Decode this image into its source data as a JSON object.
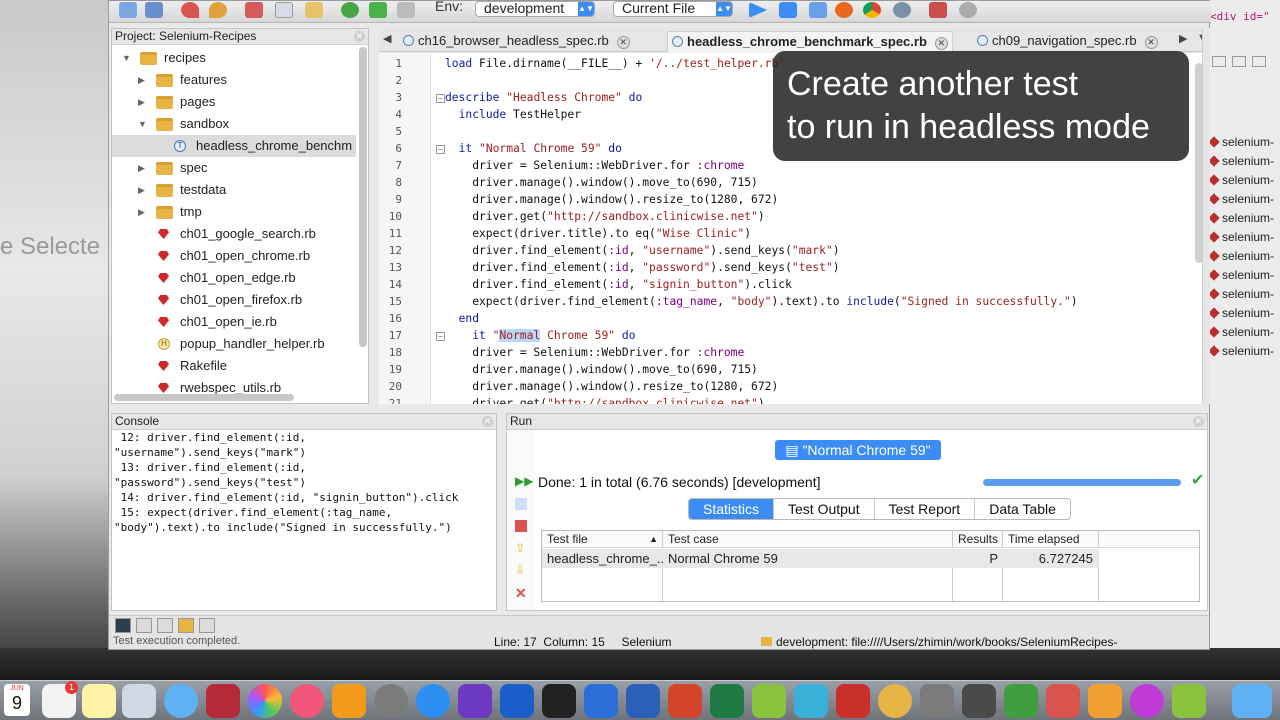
{
  "desktop": {
    "left_fragment": "e Selecte",
    "right_code": "<div id=\"",
    "right_items": [
      "selenium-",
      "selenium-",
      "selenium-",
      "selenium-",
      "selenium-",
      "selenium-",
      "selenium-",
      "selenium-",
      "selenium-",
      "selenium-",
      "selenium-",
      "selenium-"
    ]
  },
  "toolbar": {
    "env_label": "Env:",
    "env_value": "development",
    "scope_value": "Current File"
  },
  "project": {
    "title": "Project: Selenium-Recipes",
    "tree": [
      {
        "label": "recipes",
        "kind": "folder",
        "indent": 0,
        "state": "open"
      },
      {
        "label": "features",
        "kind": "folder",
        "indent": 1,
        "state": "closed"
      },
      {
        "label": "pages",
        "kind": "folder",
        "indent": 1,
        "state": "closed"
      },
      {
        "label": "sandbox",
        "kind": "folder",
        "indent": 1,
        "state": "open"
      },
      {
        "label": "headless_chrome_benchm",
        "kind": "test",
        "indent": 2,
        "state": "selected"
      },
      {
        "label": "spec",
        "kind": "folder",
        "indent": 1,
        "state": "closed"
      },
      {
        "label": "testdata",
        "kind": "folder",
        "indent": 1,
        "state": "closed"
      },
      {
        "label": "tmp",
        "kind": "folder",
        "indent": 1,
        "state": "closed"
      },
      {
        "label": "ch01_google_search.rb",
        "kind": "ruby",
        "indent": 1
      },
      {
        "label": "ch01_open_chrome.rb",
        "kind": "ruby",
        "indent": 1
      },
      {
        "label": "ch01_open_edge.rb",
        "kind": "ruby",
        "indent": 1
      },
      {
        "label": "ch01_open_firefox.rb",
        "kind": "ruby",
        "indent": 1
      },
      {
        "label": "ch01_open_ie.rb",
        "kind": "ruby",
        "indent": 1
      },
      {
        "label": "popup_handler_helper.rb",
        "kind": "helper",
        "indent": 1
      },
      {
        "label": "Rakefile",
        "kind": "ruby",
        "indent": 1
      },
      {
        "label": "rwebspec_utils.rb",
        "kind": "ruby",
        "indent": 1
      }
    ]
  },
  "tabs": [
    {
      "label": "ch16_browser_headless_spec.rb",
      "active": false
    },
    {
      "label": "headless_chrome_benchmark_spec.rb",
      "active": true
    },
    {
      "label": "ch09_navigation_spec.rb",
      "active": false
    }
  ],
  "editor": {
    "lines": [
      {
        "n": "1",
        "html": "<span class=\"kw\">load</span> File.dirname(__FILE__) + <span class=\"str\">'/../test_helper.rb'</span>"
      },
      {
        "n": "2",
        "html": ""
      },
      {
        "n": "3",
        "html": "<span class=\"kw\">describe</span> <span class=\"str\">\"Headless Chrome\"</span> <span class=\"kw\">do</span>",
        "fold": true
      },
      {
        "n": "4",
        "html": "  <span class=\"kw\">include</span> TestHelper"
      },
      {
        "n": "5",
        "html": ""
      },
      {
        "n": "6",
        "html": "  <span class=\"kw\">it</span> <span class=\"str\">\"Normal Chrome 59\"</span> <span class=\"kw\">do</span>",
        "fold": true
      },
      {
        "n": "7",
        "html": "    driver = Selenium::WebDriver.for <span class=\"sym\">:chrome</span>"
      },
      {
        "n": "8",
        "html": "    driver.manage().window().move_to(690, 715)"
      },
      {
        "n": "9",
        "html": "    driver.manage().window().resize_to(1280, 672)"
      },
      {
        "n": "10",
        "html": "    driver.get(<span class=\"str\">\"http://sandbox.clinicwise.net\"</span>)"
      },
      {
        "n": "11",
        "html": "    expect(driver.title).to eq(<span class=\"str\">\"Wise Clinic\"</span>)"
      },
      {
        "n": "12",
        "html": "    driver.find_element(<span class=\"sym\">:id</span>, <span class=\"str\">\"username\"</span>).send_keys(<span class=\"str\">\"mark\"</span>)"
      },
      {
        "n": "13",
        "html": "    driver.find_element(<span class=\"sym\">:id</span>, <span class=\"str\">\"password\"</span>).send_keys(<span class=\"str\">\"test\"</span>)"
      },
      {
        "n": "14",
        "html": "    driver.find_element(<span class=\"sym\">:id</span>, <span class=\"str\">\"signin_button\"</span>).click"
      },
      {
        "n": "15",
        "html": "    expect(driver.find_element(<span class=\"sym\">:tag_name</span>, <span class=\"str\">\"body\"</span>).text).to <span class=\"kw\">include</span>(<span class=\"str\">\"Signed in successfully.\"</span>)"
      },
      {
        "n": "16",
        "html": "  <span class=\"kw\">end</span>"
      },
      {
        "n": "17",
        "html": "    <span class=\"kw\">it</span> <span class=\"str\">\"<span class=\"hl\">Normal</span> Chrome 59\"</span> <span class=\"kw\">do</span>",
        "fold": true
      },
      {
        "n": "18",
        "html": "    driver = Selenium::WebDriver.for <span class=\"sym\">:chrome</span>"
      },
      {
        "n": "19",
        "html": "    driver.manage().window().move_to(690, 715)"
      },
      {
        "n": "20",
        "html": "    driver.manage().window().resize_to(1280, 672)"
      },
      {
        "n": "21",
        "html": "    driver.get(<span class=\"str\">\"http://sandbox.clinicwise.net\"</span>)"
      }
    ]
  },
  "overlay": {
    "line1": "Create another test",
    "line2": "to run in headless mode"
  },
  "console": {
    "title": "Console",
    "lines": [
      " 12: driver.find_element(:id,",
      "\"username\").send_keys(\"mark\")",
      " 13: driver.find_element(:id,",
      "\"password\").send_keys(\"test\")",
      " 14: driver.find_element(:id, \"signin_button\").click",
      " 15: expect(driver.find_element(:tag_name,",
      "\"body\").text).to include(\"Signed in successfully.\")"
    ]
  },
  "run": {
    "title": "Run",
    "badge": "\"Normal Chrome 59\"",
    "done_text": "Done: 1 in total (6.76 seconds) [development]",
    "progress": 1.0,
    "segments": [
      {
        "label": "Statistics",
        "active": true
      },
      {
        "label": "Test Output",
        "active": false
      },
      {
        "label": "Test Report",
        "active": false
      },
      {
        "label": "Data Table",
        "active": false
      }
    ],
    "columns": [
      "Test file",
      "Test case",
      "Results",
      "Time elapsed"
    ],
    "rows": [
      {
        "file": "headless_chrome_...",
        "case": "Normal Chrome 59",
        "result": "P",
        "time": "6.727245"
      }
    ]
  },
  "statusbar": {
    "message": "Test execution completed.",
    "line_label": "Line:",
    "line_value": "17",
    "col_label": "Column:",
    "col_value": "15",
    "mode": "Selenium",
    "branch": "development: file:////Users/zhimin/work/books/SeleniumRecipes-"
  },
  "dock": {
    "date": "9",
    "month": "JUN",
    "badge": "1"
  },
  "colors": {
    "accent": "#3b8df5",
    "keyword": "#1018a8",
    "string": "#9b1d1d",
    "symbol": "#7a0080",
    "selection": "#bcd7f5"
  }
}
